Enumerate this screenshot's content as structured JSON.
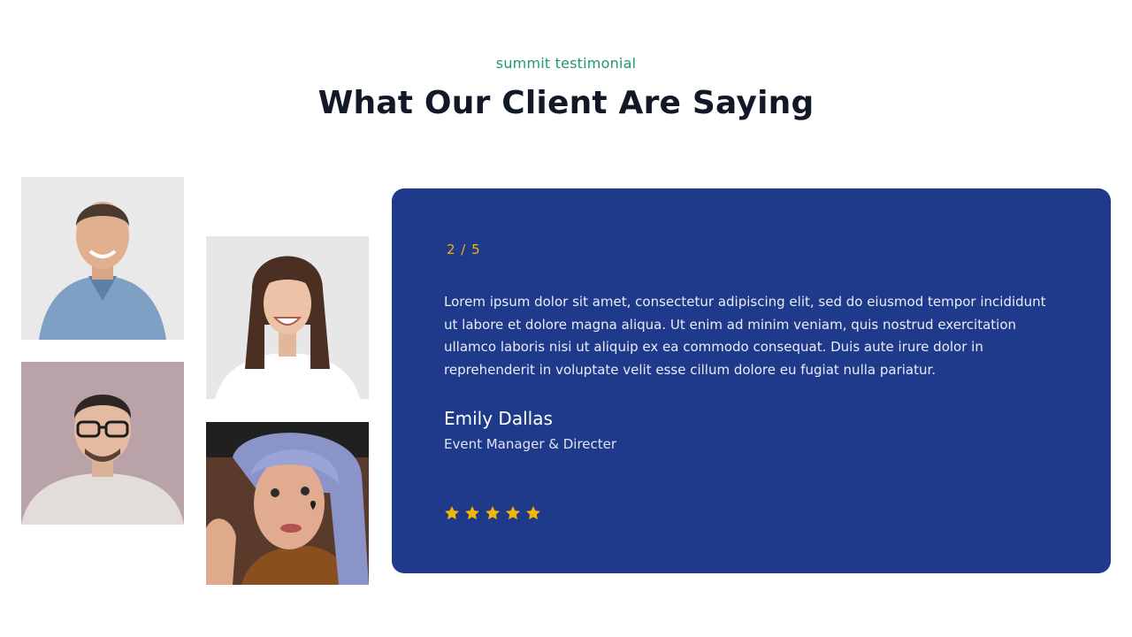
{
  "section": {
    "eyebrow": "summit testimonial",
    "title": "What Our Client Are Saying"
  },
  "photos": [
    {
      "name": "client-photo-man-blue-shirt",
      "bg": "#e9e9ea"
    },
    {
      "name": "client-photo-man-glasses",
      "bg": "#b9a3a8"
    },
    {
      "name": "client-photo-woman-smiling",
      "bg": "#e7e7e8"
    },
    {
      "name": "client-photo-woman-blue-hair",
      "bg": "#5a3b2b"
    }
  ],
  "testimonial": {
    "counter": "2 / 5",
    "quote": "Lorem ipsum dolor sit amet, consectetur adipiscing elit, sed do eiusmod tempor incididunt ut labore et dolore magna aliqua. Ut enim ad minim veniam, quis nostrud exercitation ullamco laboris nisi ut aliquip ex ea commodo consequat. Duis aute irure dolor in reprehenderit in voluptate velit esse cillum dolore eu fugiat nulla pariatur.",
    "author_name": "Emily Dallas",
    "author_role": "Event Manager & Directer",
    "rating": 5,
    "rating_max": 5
  },
  "colors": {
    "accent_green": "#1f9a6b",
    "card_bg": "#1f3a8a",
    "star": "#f2b705"
  },
  "icons": {
    "rating": "star-icon"
  }
}
